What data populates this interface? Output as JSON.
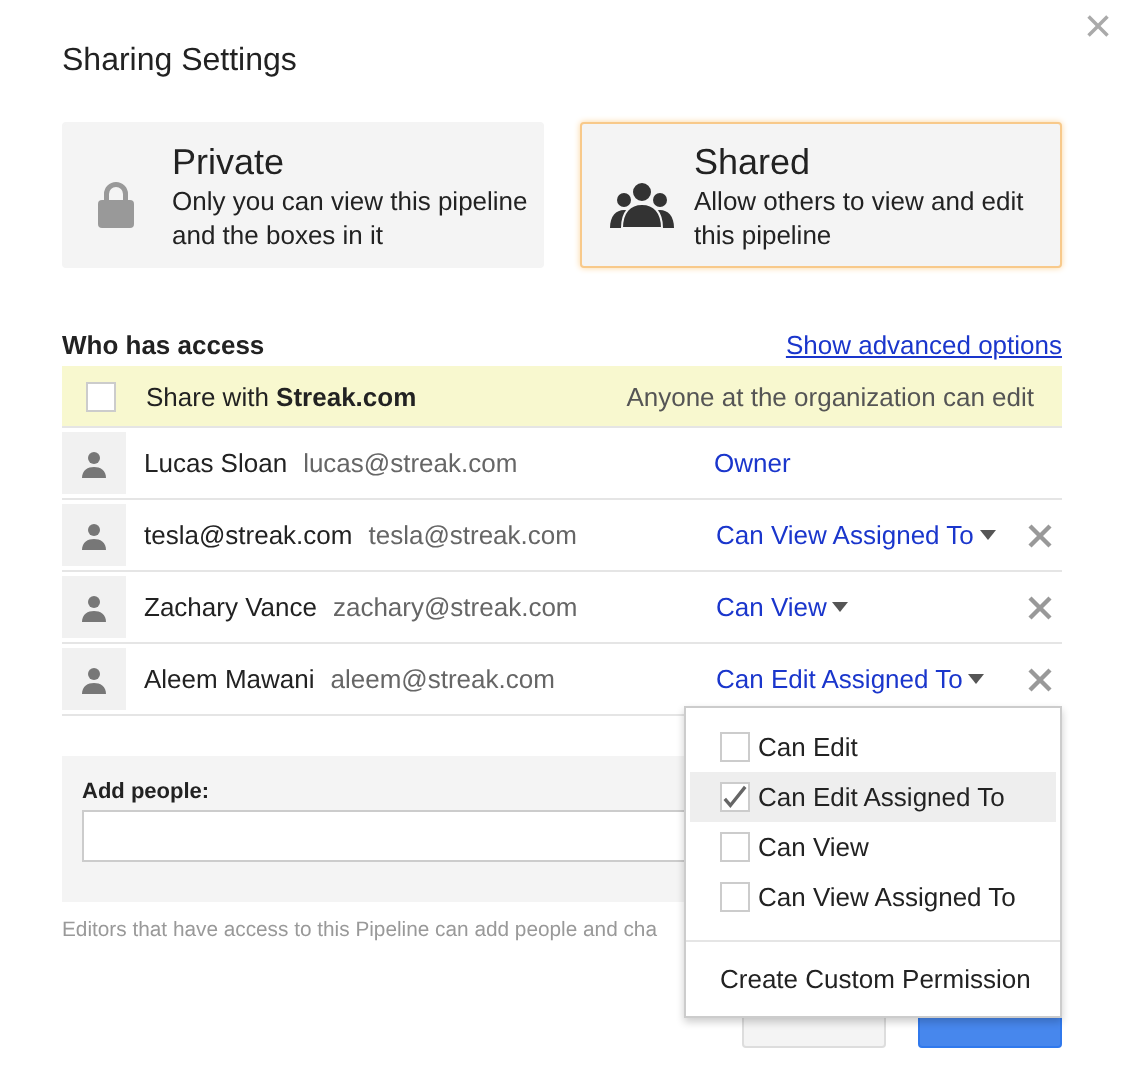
{
  "dialog": {
    "title": "Sharing Settings",
    "close": "×"
  },
  "modes": [
    {
      "kind": "private",
      "title": "Private",
      "description": "Only you can view this pipeline and the boxes in it",
      "selected": false
    },
    {
      "kind": "shared",
      "title": "Shared",
      "description": "Allow others to view and edit this pipeline",
      "selected": true
    }
  ],
  "access": {
    "heading": "Who has access",
    "advanced_link": "Show advanced options",
    "org_share": {
      "checked": false,
      "label": "Share with **Streak.com**",
      "note": "Anyone at the organization can edit"
    },
    "people": [
      {
        "name": "Lucas Sloan",
        "email": "lucas@streak.com",
        "permission": "Owner",
        "dropdown": false,
        "removable": false
      },
      {
        "name": "tesla@streak.com",
        "email": "tesla@streak.com",
        "permission": "Can View Assigned To",
        "dropdown": true,
        "removable": true
      },
      {
        "name": "Zachary Vance",
        "email": "zachary@streak.com",
        "permission": "Can View",
        "dropdown": true,
        "removable": true
      },
      {
        "name": "Aleem Mawani",
        "email": "aleem@streak.com",
        "permission": "Can Edit Assigned To",
        "dropdown": true,
        "removable": true
      }
    ]
  },
  "add_people": {
    "label": "Add people:"
  },
  "footnote": "Editors that have access to this Pipeline can add people and cha",
  "footer_buttons": [
    {
      "kind": "secondary"
    },
    {
      "kind": "primary"
    }
  ],
  "permission_menu": {
    "options": [
      {
        "label": "Can Edit",
        "checked": false,
        "selected": false
      },
      {
        "label": "Can Edit Assigned To",
        "checked": true,
        "selected": true
      },
      {
        "label": "Can View",
        "checked": false,
        "selected": false
      },
      {
        "label": "Can View Assigned To",
        "checked": false,
        "selected": false
      }
    ],
    "custom": "Create Custom Permission"
  }
}
